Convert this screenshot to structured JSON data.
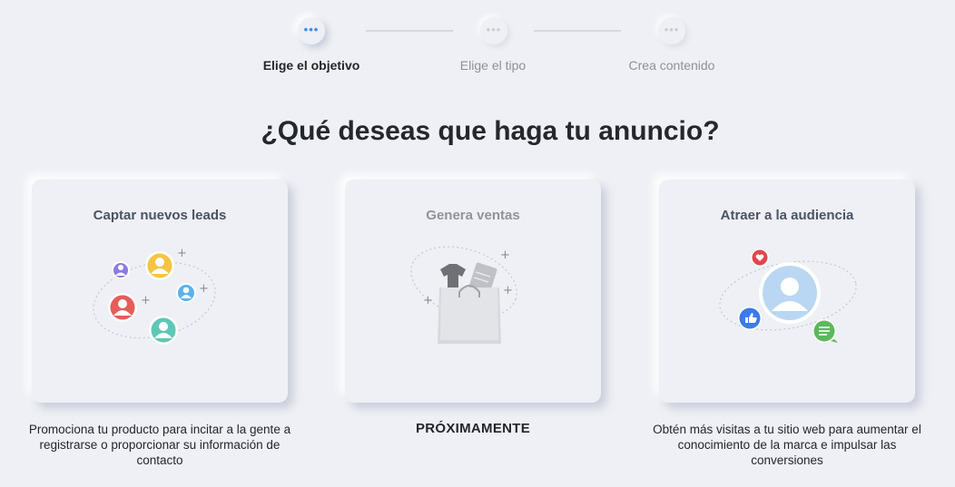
{
  "stepper": {
    "steps": [
      {
        "label": "Elige el objetivo",
        "state": "active",
        "icon": "dots-icon"
      },
      {
        "label": "Elige el tipo",
        "state": "inactive",
        "icon": "dots-icon"
      },
      {
        "label": "Crea contenido",
        "state": "inactive",
        "icon": "dots-icon"
      }
    ],
    "dot_glyph": "•••"
  },
  "title": "¿Qué deseas que haga tu anuncio?",
  "cards": [
    {
      "title": "Captar nuevos leads",
      "description": "Promociona tu producto para incitar a la gente a registrarse o proporcionar su información de contacto",
      "illustration": "people-network-icon",
      "enabled": true
    },
    {
      "title": "Genera ventas",
      "status": "PRÓXIMAMENTE",
      "illustration": "shopping-bag-icon",
      "enabled": false
    },
    {
      "title": "Atraer a la audiencia",
      "description": "Obtén más visitas a tu sitio web para aumentar el conocimiento de la marca e impulsar las conversiones",
      "illustration": "audience-engagement-icon",
      "enabled": true
    }
  ],
  "colors": {
    "background": "#eef0f5",
    "accent": "#3f8cf0",
    "heart": "#e0474c",
    "like": "#3b7be8",
    "comment": "#5cb85c"
  }
}
